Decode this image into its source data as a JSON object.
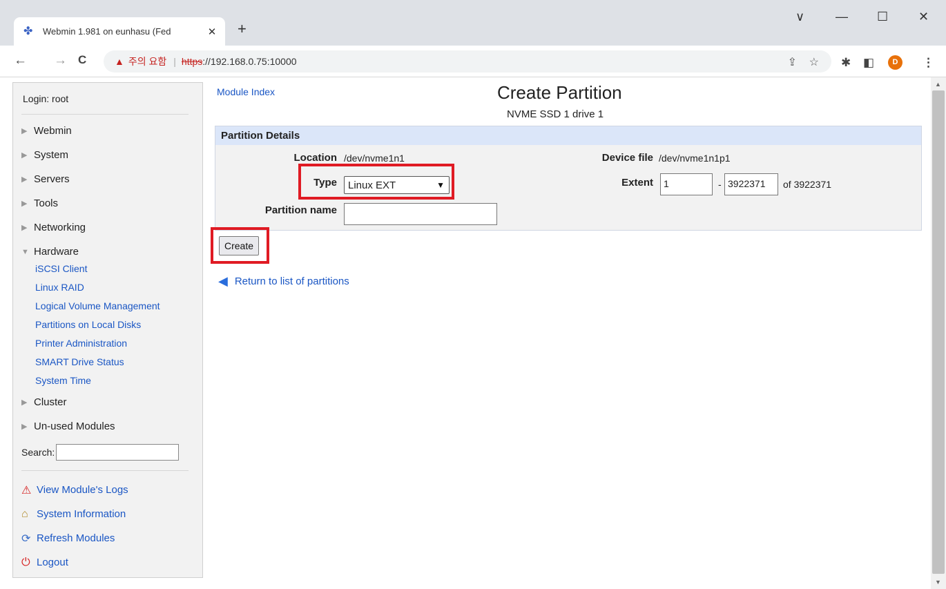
{
  "browser": {
    "tab_title": "Webmin 1.981 on eunhasu (Fed",
    "tab_close": "✕",
    "new_tab": "+",
    "window_controls": {
      "chevron": "∨",
      "minimize": "—",
      "maximize": "☐",
      "close": "✕"
    },
    "nav": {
      "back": "←",
      "forward": "→",
      "reload": "C"
    },
    "security_warning": "주의 요함",
    "url_scheme": "https",
    "url_rest": "://192.168.0.75:10000",
    "profile_initial": "D",
    "icons": [
      "share-icon",
      "bookmark-star-icon",
      "extensions-icon",
      "sidebar-icon",
      "menu-icon"
    ]
  },
  "sidebar": {
    "login": "Login: root",
    "categories": [
      {
        "label": "Webmin",
        "expanded": false
      },
      {
        "label": "System",
        "expanded": false
      },
      {
        "label": "Servers",
        "expanded": false
      },
      {
        "label": "Tools",
        "expanded": false
      },
      {
        "label": "Networking",
        "expanded": false
      },
      {
        "label": "Hardware",
        "expanded": true
      }
    ],
    "hardware_items": [
      "iSCSI Client",
      "Linux RAID",
      "Logical Volume Management",
      "Partitions on Local Disks",
      "Printer Administration",
      "SMART Drive Status",
      "System Time"
    ],
    "categories_after": [
      {
        "label": "Cluster"
      },
      {
        "label": "Un-used Modules"
      }
    ],
    "search_label": "Search:",
    "search_value": "",
    "bottom_links": [
      {
        "label": "View Module's Logs",
        "icon": "warning-icon"
      },
      {
        "label": "System Information",
        "icon": "home-icon"
      },
      {
        "label": "Refresh Modules",
        "icon": "refresh-icon"
      },
      {
        "label": "Logout",
        "icon": "power-icon"
      }
    ]
  },
  "main": {
    "module_index": "Module Index",
    "title": "Create Partition",
    "subtitle": "NVME SSD 1 drive 1",
    "panel_title": "Partition Details",
    "location_label": "Location",
    "location_value": "/dev/nvme1n1",
    "device_file_label": "Device file",
    "device_file_value": "/dev/nvme1n1p1",
    "type_label": "Type",
    "type_value": "Linux EXT",
    "extent_label": "Extent",
    "extent_start": "1",
    "extent_sep": "-",
    "extent_end": "3922371",
    "extent_of": "of 3922371",
    "partition_name_label": "Partition name",
    "partition_name_value": "",
    "create_button": "Create",
    "return_link": "Return to list of partitions"
  },
  "colors": {
    "link": "#1a56c4",
    "highlight": "#e01b24",
    "panel_header": "#dbe6f9",
    "warning": "#c5221f"
  }
}
